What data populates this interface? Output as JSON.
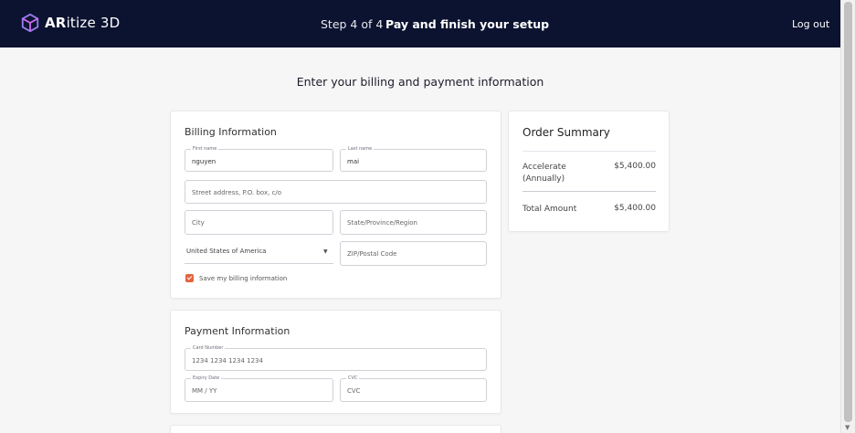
{
  "header": {
    "brand_bold": "AR",
    "brand_rest": "itize 3D",
    "step": "Step 4 of 4",
    "title": "Pay and finish your setup",
    "logout": "Log out"
  },
  "page": {
    "heading": "Enter your billing and payment information"
  },
  "billing": {
    "title": "Billing Information",
    "first_name": {
      "label": "First name",
      "value": "nguyen"
    },
    "last_name": {
      "label": "Last name",
      "value": "mai"
    },
    "street": {
      "placeholder": "Street address, P.O. box, c/o"
    },
    "city": {
      "placeholder": "City"
    },
    "state": {
      "placeholder": "State/Province/Region"
    },
    "country": {
      "value": "United States of America"
    },
    "zip": {
      "placeholder": "ZIP/Postal Code"
    },
    "save_label": "Save my billing information",
    "save_checked": true
  },
  "payment": {
    "title": "Payment Information",
    "card_number": {
      "label": "Card Number",
      "placeholder": "1234 1234 1234 1234"
    },
    "expiry": {
      "label": "Expiry Date",
      "placeholder": "MM / YY"
    },
    "cvc": {
      "label": "CVC",
      "placeholder": "CVC"
    }
  },
  "summary": {
    "title": "Order Summary",
    "item_line1": "Accelerate",
    "item_line2": "(Annually)",
    "item_amount": "$5,400.00",
    "total_label": "Total Amount",
    "total_amount": "$5,400.00"
  },
  "colors": {
    "header_bg": "#0c1330",
    "accent": "#e2643f",
    "logo": "#9b7cf0"
  }
}
